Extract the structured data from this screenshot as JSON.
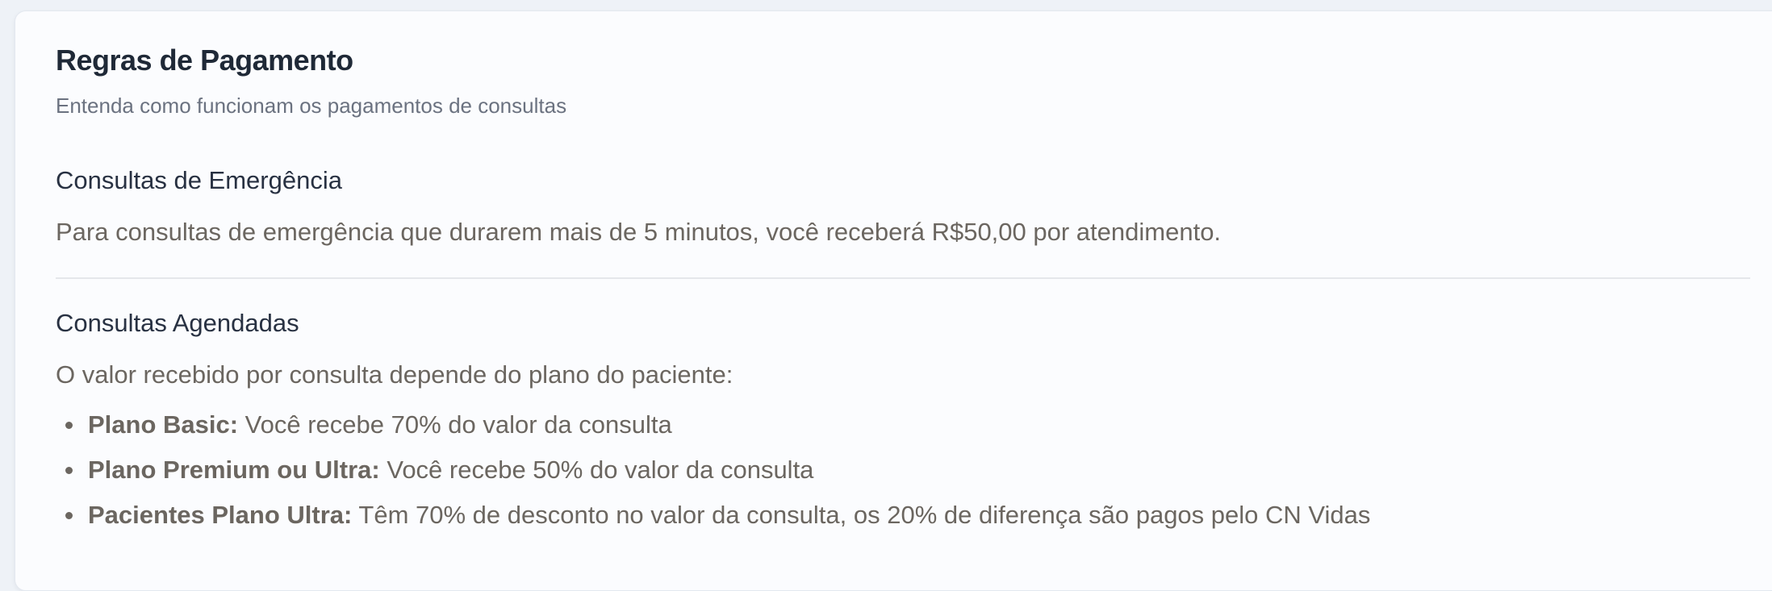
{
  "card": {
    "title": "Regras de Pagamento",
    "subtitle": "Entenda como funcionam os pagamentos de consultas"
  },
  "emergency": {
    "heading": "Consultas de Emergência",
    "text": "Para consultas de emergência que durarem mais de 5 minutos, você receberá R$50,00 por atendimento."
  },
  "scheduled": {
    "heading": "Consultas Agendadas",
    "intro": "O valor recebido por consulta depende do plano do paciente:",
    "rules": [
      {
        "label": "Plano Basic:",
        "text": " Você recebe 70% do valor da consulta"
      },
      {
        "label": "Plano Premium ou Ultra:",
        "text": " Você recebe 50% do valor da consulta"
      },
      {
        "label": "Pacientes Plano Ultra:",
        "text": " Têm 70% de desconto no valor da consulta, os 20% de diferença são pagos pelo CN Vidas"
      }
    ]
  },
  "colors": {
    "title": "#1f2937",
    "subtitle": "#6b7280",
    "body_text": "#6b6660",
    "card_background": "#fbfcfe",
    "divider": "#e5e7eb"
  }
}
